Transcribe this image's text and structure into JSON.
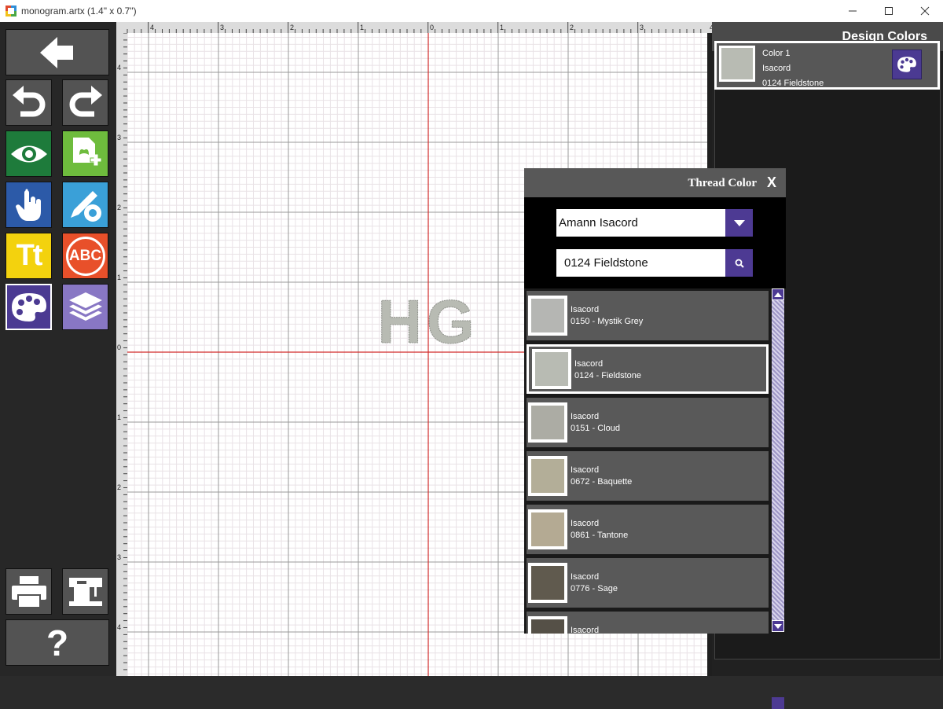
{
  "window": {
    "title": "monogram.artx (1.4\" x 0.7\")"
  },
  "toolbar": {
    "back": "back-icon",
    "undo": "undo-icon",
    "redo": "redo-icon",
    "preview": "eye-icon",
    "add_design": "add-design-icon",
    "select": "hand-pointer-icon",
    "edit_settings": "pencil-gear-icon",
    "text": "Tt",
    "monogram": "ABC",
    "colors": "palette-icon",
    "layers": "layers-icon",
    "print": "printer-icon",
    "send_to_machine": "sewing-machine-icon",
    "help": "?"
  },
  "canvas": {
    "rulers_top": [
      "4",
      "3",
      "2",
      "1",
      "0",
      "1",
      "2",
      "3",
      "4"
    ],
    "rulers_left": [
      "4",
      "3",
      "2",
      "1",
      "0",
      "1",
      "2",
      "3",
      "4"
    ],
    "monogram_text": "HG",
    "thread_color": "#b8bbb3"
  },
  "design_colors": {
    "title": "Design Colors",
    "items": [
      {
        "label": "Color 1",
        "brand": "Isacord",
        "code": "0124 Fieldstone",
        "swatch": "#b8bbb3"
      }
    ]
  },
  "thread_dialog": {
    "title": "Thread Color",
    "close": "X",
    "brand_select": "Amann Isacord",
    "search_value": "0124 Fieldstone",
    "colors": [
      {
        "brand": "Isacord",
        "name": "0150 - Mystik Grey",
        "swatch": "#b5b6b3",
        "selected": false
      },
      {
        "brand": "Isacord",
        "name": "0124 - Fieldstone",
        "swatch": "#b8bbb3",
        "selected": true
      },
      {
        "brand": "Isacord",
        "name": "0151 - Cloud",
        "swatch": "#acaca4",
        "selected": false
      },
      {
        "brand": "Isacord",
        "name": "0672 - Baquette",
        "swatch": "#b3ae98",
        "selected": false
      },
      {
        "brand": "Isacord",
        "name": "0861 - Tantone",
        "swatch": "#b4aa93",
        "selected": false
      },
      {
        "brand": "Isacord",
        "name": "0776 - Sage",
        "swatch": "#605a4e",
        "selected": false
      },
      {
        "brand": "Isacord",
        "name": "",
        "swatch": "#555047",
        "selected": false
      }
    ]
  },
  "colors": {
    "accent": "#4d3a93",
    "guide": "#d22b2b"
  }
}
